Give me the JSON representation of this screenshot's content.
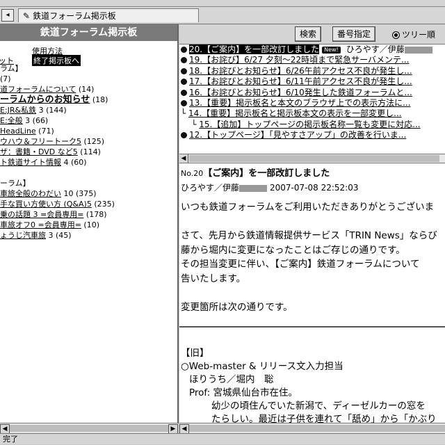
{
  "window": {
    "tab_title": "鉄道フォーラム掲示板",
    "status": "完了"
  },
  "left": {
    "title": "鉄道フォーラム掲示板",
    "link_usage": "使用方法",
    "link_exit": "終了掲示板へ",
    "link_at": "ット",
    "rows": [
      {
        "text": "ラム】",
        "count": "",
        "style": "sec"
      },
      {
        "text": "",
        "count": "(7)",
        "style": ""
      },
      {
        "text": "道フォーラムについて",
        "count": "(14)",
        "style": ""
      },
      {
        "text": "ーラムからのお知らせ",
        "count": "(18)",
        "style": "big"
      },
      {
        "text": "E:JR&私鉄",
        "count": "3 (144)",
        "style": ""
      },
      {
        "text": "E:全般",
        "count": "3 (66)",
        "style": ""
      },
      {
        "text": "HeadLine",
        "count": "(71)",
        "style": ""
      },
      {
        "text": "ウハウ＆フリートーク5",
        "count": "(125)",
        "style": ""
      },
      {
        "text": "ザ：書籍・DVD など5",
        "count": "(114)",
        "style": ""
      },
      {
        "text": "ト鉄道サイト情報",
        "count": "4 (60)",
        "style": ""
      },
      {
        "text": "",
        "count": "",
        "style": "sec"
      },
      {
        "text": "ーラム】",
        "count": "",
        "style": "sec"
      },
      {
        "text": "車旅全般のわだい",
        "count": "10 (375)",
        "style": ""
      },
      {
        "text": "手な買い方使い方 (Q&A)5",
        "count": "(235)",
        "style": ""
      },
      {
        "text": "乗の話題 3 =会員専用=",
        "count": "(178)",
        "style": ""
      },
      {
        "text": "車旅オフ0 =会員専用=",
        "count": "(10)",
        "style": ""
      },
      {
        "text": "ょうじ汽車旅",
        "count": "3 (45)",
        "style": ""
      }
    ]
  },
  "toolbar": {
    "search_label": "検索",
    "number_label": "番号指定",
    "tree_label": "ツリー順"
  },
  "tree": {
    "new_badge": "New!",
    "rows": [
      {
        "indent": "",
        "text": "20.【ご案内】を一部改訂しました",
        "author": "ひろやす／伊藤",
        "selected": true,
        "bullet": true
      },
      {
        "indent": "",
        "text": "19.【お詫び】6/27 夕刻〜22時頃まで緊急サーバメンテ...",
        "author": "",
        "selected": false,
        "bullet": true
      },
      {
        "indent": "",
        "text": "18.【お詫びとお知らせ】6/26午前アクセス不良が発生し...",
        "author": "",
        "selected": false,
        "bullet": true
      },
      {
        "indent": "",
        "text": "17.【お詫びとお知らせ】6/11午前アクセス不良が発生し...",
        "author": "",
        "selected": false,
        "bullet": true
      },
      {
        "indent": "",
        "text": "16.【お詫びとお知らせ】6/10発生した鉄道フォーラムと...",
        "author": "",
        "selected": false,
        "bullet": true
      },
      {
        "indent": "",
        "text": "13.【重要】掲示板名と本文のブラウザ上での表示方法に...",
        "author": "",
        "selected": false,
        "bullet": true
      },
      {
        "indent": "└ ",
        "text": "14.【重要】掲示板名と掲示板本文の表示を一部変更し...",
        "author": "",
        "selected": false,
        "bullet": false
      },
      {
        "indent": "    └ ",
        "text": "15.【追加】トップページの掲示板名称一覧も変更に対応...",
        "author": "",
        "selected": false,
        "bullet": false
      },
      {
        "indent": "",
        "text": "12.【トップページ】「見やすさアップ」の改善を行いま...",
        "author": "",
        "selected": false,
        "bullet": true
      }
    ]
  },
  "message": {
    "number": "No.20",
    "title": "【ご案内】を一部改訂しました",
    "author": "ひろやす／伊藤",
    "date": "2007-07-08 22:52:03",
    "body": [
      "いつも鉄道フォーラムをご利用いただきありがとうございま",
      "",
      "さて、先月から鉄道情報提供サービス「TRIN News」ならび",
      "藤から堀内に変更になったことはご存じの通りです。",
      "その担当変更に伴い、【ご案内】鉄道フォーラムについて",
      "告いたします。",
      "",
      "変更箇所は次の通りです。"
    ],
    "sig": [
      "【旧】",
      "○Web-master & リリース文入力担当",
      "ほりうち／堀内　聡",
      "Prof: 宮城県仙台市在住。",
      "幼少の頃住んでいた新潟で、ディーゼルカーの窓を",
      "たらしい。最近は子供を連れて「舐め」から「かぶり"
    ]
  }
}
